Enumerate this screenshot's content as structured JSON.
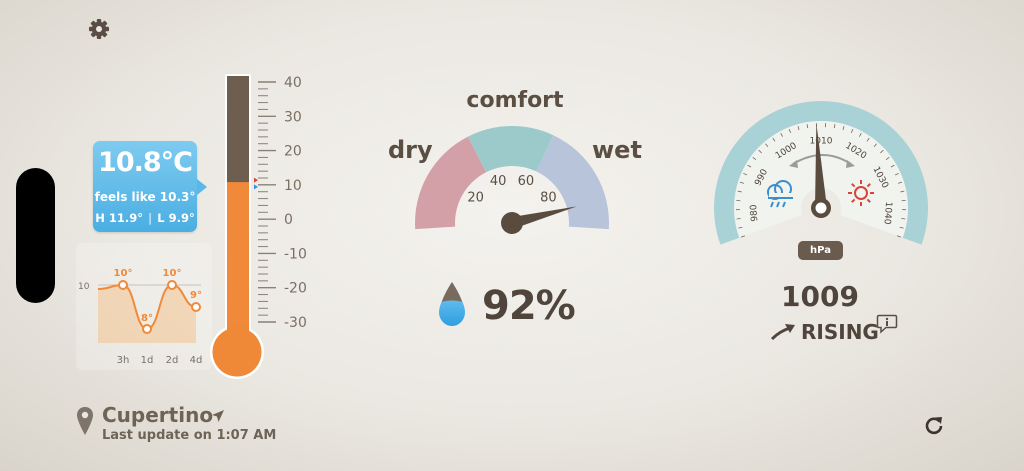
{
  "settings": {
    "icon": "gear-icon"
  },
  "current": {
    "temperature": "10.8°C",
    "feels_like": "feels like 10.3°",
    "high": "H 11.9°",
    "low": "L 9.9°",
    "level": 10.8,
    "feels_level": 10.3,
    "accent_color": "#4aaee2"
  },
  "thermometer": {
    "scale": [
      "40",
      "30",
      "20",
      "10",
      "0",
      "-10",
      "-20",
      "-30"
    ],
    "min": -30,
    "max": 40,
    "mercury_color": "#f08a3a",
    "tube_color": "#6e5e50"
  },
  "forecast": {
    "reference_label": "10",
    "points": [
      {
        "label": "10°",
        "value": 10
      },
      {
        "label": "8°",
        "value": 8
      },
      {
        "label": "10°",
        "value": 10
      },
      {
        "label": "9°",
        "value": 9
      }
    ],
    "x_labels": [
      "3h",
      "1d",
      "2d",
      "4d"
    ],
    "line_color": "#f08a3a"
  },
  "location": {
    "city": "Cupertino",
    "last_update": "Last update on 1:07 AM",
    "icon": "location-pin-icon",
    "arrow_icon": "location-arrow-icon"
  },
  "comfort": {
    "title": "comfort",
    "dry_label": "dry",
    "wet_label": "wet",
    "ticks": [
      "20",
      "40",
      "60",
      "80"
    ],
    "humidity": 92,
    "colors": {
      "dry": "#d4a0a8",
      "comfort": "#9ccaca",
      "wet": "#b8c4da"
    }
  },
  "humidity": {
    "value": "92%",
    "icon": "water-drop-icon"
  },
  "barometer": {
    "ticks": [
      "980",
      "990",
      "1000",
      "1010",
      "1020",
      "1030",
      "1040"
    ],
    "unit": "hPa",
    "value": "1009",
    "pressure": 1009,
    "trend": "RISING",
    "rain_icon": "rain-cloud-icon",
    "sun_icon": "sun-icon",
    "trend_icon": "rising-arrow-icon",
    "info_icon": "info-bubble-icon",
    "dial_color": "#b8dde0"
  },
  "refresh": {
    "icon": "refresh-icon"
  }
}
